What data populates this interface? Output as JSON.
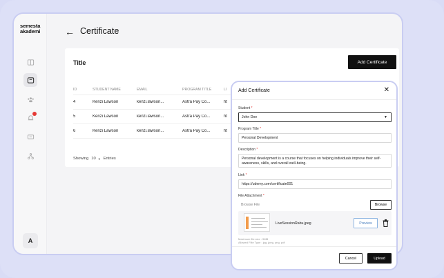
{
  "brand": {
    "logo_line1": "semesta",
    "logo_line2": "akademi"
  },
  "sidebar": {
    "items": [
      {
        "icon": "book-icon"
      },
      {
        "icon": "certificate-icon",
        "active": true
      },
      {
        "icon": "users-icon"
      },
      {
        "icon": "bell-icon",
        "badge": true
      },
      {
        "icon": "ticket-icon"
      },
      {
        "icon": "network-icon"
      }
    ],
    "avatar_initial": "A"
  },
  "header": {
    "back": "←",
    "title": "Certificate"
  },
  "card": {
    "title": "Title",
    "add_button": "Add Certificate",
    "columns": [
      "ID",
      "STUDENT NAME",
      "EMAIL",
      "PROGRAM TITLE",
      "LI"
    ],
    "rows": [
      {
        "id": "4",
        "name": "Kenzi Lawson",
        "email": "kenzi.lawson...",
        "program": "Astra Pay Co...",
        "link": "ht"
      },
      {
        "id": "5",
        "name": "Kenzi Lawson",
        "email": "kenzi.lawson...",
        "program": "Astra Pay Co...",
        "link": "ht"
      },
      {
        "id": "6",
        "name": "Kenzi Lawson",
        "email": "kenzi.lawson...",
        "program": "Astra Pay Co...",
        "link": "ht"
      }
    ],
    "showing_label": "Showing",
    "page_size": "10",
    "entries_label": "Entries"
  },
  "modal": {
    "title": "Add Certificate",
    "close": "✕",
    "student_label": "Student",
    "student_value": "John Doe",
    "program_label": "Program Title",
    "program_value": "Personal Development",
    "description_label": "Description",
    "description_value": "Personal development is a course that focuses on helping individuals improve their self-awareness, skills, and overall well-being.",
    "link_label": "Link",
    "link_value": "https://udemy.com/certificate001",
    "file_label": "File Attachment",
    "file_placeholder": "Browse File",
    "browse_button": "Browse",
    "attachment_name": "LiveSessionRabu.jpeg",
    "preview_button": "Preview",
    "hint_size": "Maximum file size : 5MB",
    "hint_types": "Allowed Filte Type : jpg, jpeg, png, pdf",
    "cancel_button": "Cancel",
    "upload_button": "Upload",
    "required_mark": "*"
  }
}
